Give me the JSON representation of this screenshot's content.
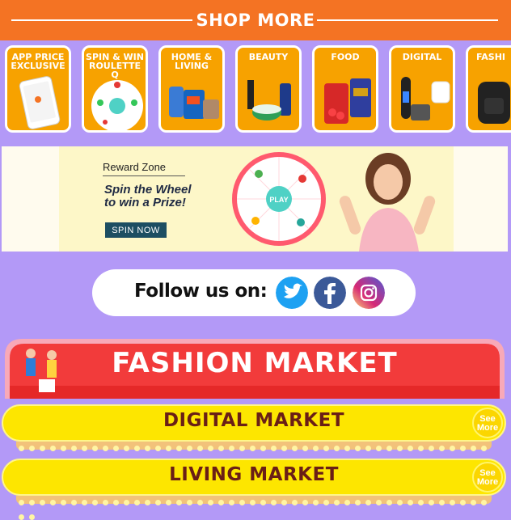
{
  "shop_more": {
    "title": "SHOP MORE"
  },
  "categories": [
    {
      "label": "APP PRICE EXCLUSIVE",
      "line1": "APP PRICE",
      "line2": "EXCLUSIVE"
    },
    {
      "label": "SPIN & WIN ROULETTE Q",
      "line1": "SPIN & WIN",
      "line2": "ROULETTE Q"
    },
    {
      "label": "HOME & LIVING",
      "line1": "HOME &",
      "line2": "LIVING"
    },
    {
      "label": "BEAUTY",
      "line1": "BEAUTY",
      "line2": ""
    },
    {
      "label": "FOOD",
      "line1": "FOOD",
      "line2": ""
    },
    {
      "label": "DIGITAL",
      "line1": "DIGITAL",
      "line2": ""
    },
    {
      "label": "FASHI",
      "line1": "FASHI",
      "line2": ""
    }
  ],
  "reward_banner": {
    "zone": "Reward Zone",
    "headline_1": "Spin the Wheel",
    "headline_2": "to win a Prize!",
    "button": "SPIN NOW",
    "wheel_center": "PLAY"
  },
  "follow": {
    "text": "Follow us on:"
  },
  "markets": {
    "fashion": "FASHION MARKET",
    "digital": "DIGITAL MARKET",
    "living": "LIVING MARKET",
    "see_more_1": "See",
    "see_more_2": "More"
  },
  "colors": {
    "page_bg": "#b399f7",
    "header_orange": "#f47323",
    "tile_orange": "#f7a200",
    "market_yellow": "#fde600",
    "market_text": "#6a1f16",
    "fashion_red": "#f23b3b"
  },
  "icons": [
    "twitter-icon",
    "facebook-icon",
    "instagram-icon"
  ]
}
